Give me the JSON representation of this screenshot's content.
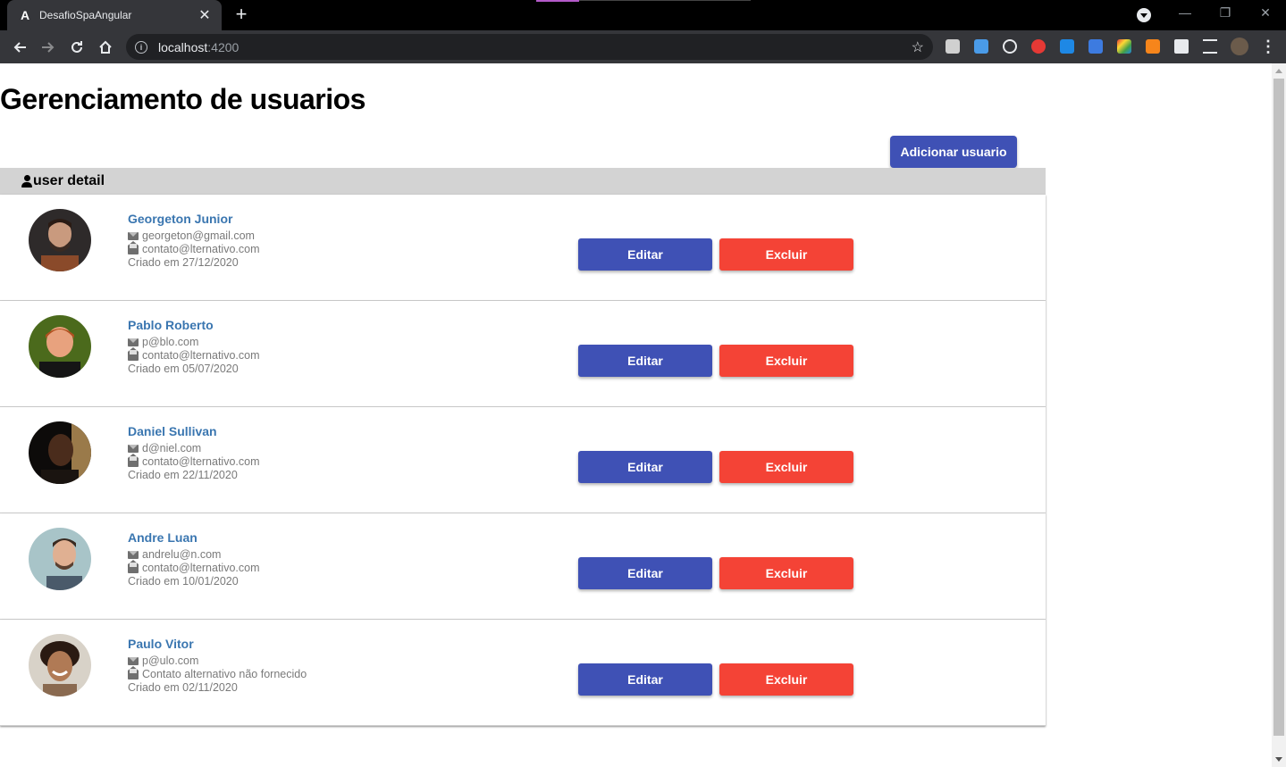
{
  "browser": {
    "tab_title": "DesafioSpaAngular",
    "tab_favicon": "A",
    "tab_close": "✕",
    "new_tab": "+",
    "url_host": "localhost",
    "url_port": ":4200",
    "menu": "⋮"
  },
  "page": {
    "title": "Gerenciamento de usuarios",
    "add_button": "Adicionar usuario",
    "list_header": "user detail",
    "edit_label": "Editar",
    "delete_label": "Excluir"
  },
  "users": [
    {
      "name": "Georgeton Junior",
      "email": "georgeton@gmail.com",
      "alt_contact": "contato@lternativo.com",
      "created": "Criado em 27/12/2020"
    },
    {
      "name": "Pablo Roberto",
      "email": "p@blo.com",
      "alt_contact": "contato@lternativo.com",
      "created": "Criado em 05/07/2020"
    },
    {
      "name": "Daniel Sullivan",
      "email": "d@niel.com",
      "alt_contact": "contato@lternativo.com",
      "created": "Criado em 22/11/2020"
    },
    {
      "name": "Andre Luan",
      "email": "andrelu@n.com",
      "alt_contact": "contato@lternativo.com",
      "created": "Criado em 10/01/2020"
    },
    {
      "name": "Paulo Vitor",
      "email": "p@ulo.com",
      "alt_contact": "Contato alternativo não fornecido",
      "created": "Criado em 02/11/2020"
    }
  ],
  "colors": {
    "primary": "#3f51b5",
    "warn": "#f44336",
    "name_link": "#3a76b0",
    "header_bg": "#d3d3d3"
  }
}
